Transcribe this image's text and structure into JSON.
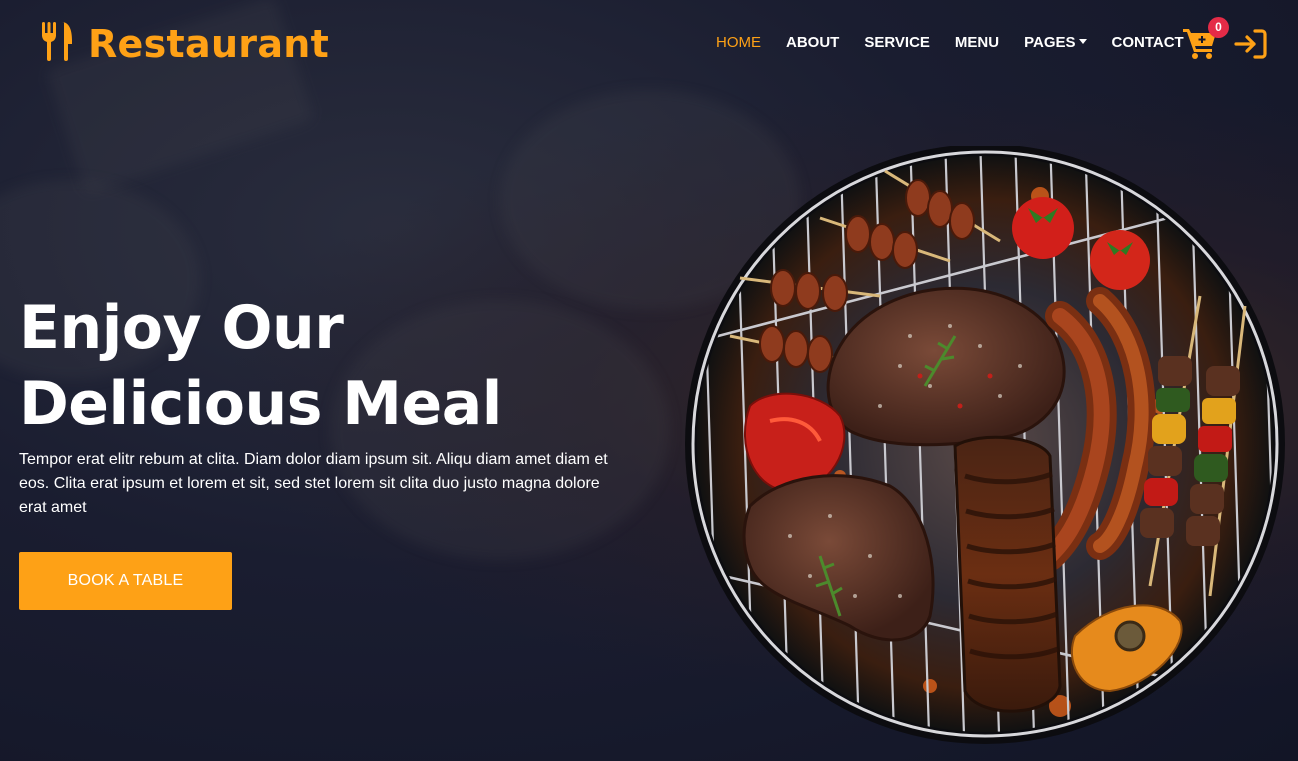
{
  "brand": {
    "name": "Restaurant",
    "icon": "utensils-icon",
    "color": "#FEA116"
  },
  "nav": {
    "items": [
      {
        "label": "HOME",
        "active": true
      },
      {
        "label": "ABOUT",
        "active": false
      },
      {
        "label": "SERVICE",
        "active": false
      },
      {
        "label": "MENU",
        "active": false
      },
      {
        "label": "PAGES",
        "active": false,
        "dropdown": true
      },
      {
        "label": "CONTACT",
        "active": false
      }
    ],
    "cart": {
      "icon": "shopping-cart-icon",
      "count": "0"
    },
    "login": {
      "icon": "sign-in-icon"
    }
  },
  "hero": {
    "title_line1": "Enjoy Our",
    "title_line2": "Delicious Meal",
    "text": "Tempor erat elitr rebum at clita. Diam dolor diam ipsum sit. Aliqu diam amet diam et eos. Clita erat ipsum et lorem et sit, sed stet lorem sit clita duo justo magna dolore erat amet",
    "button_label": "BOOK A TABLE",
    "image": "grilled-meat-bbq-image"
  },
  "colors": {
    "accent": "#FEA116",
    "background": "#14172a",
    "badge": "#e42b47"
  }
}
